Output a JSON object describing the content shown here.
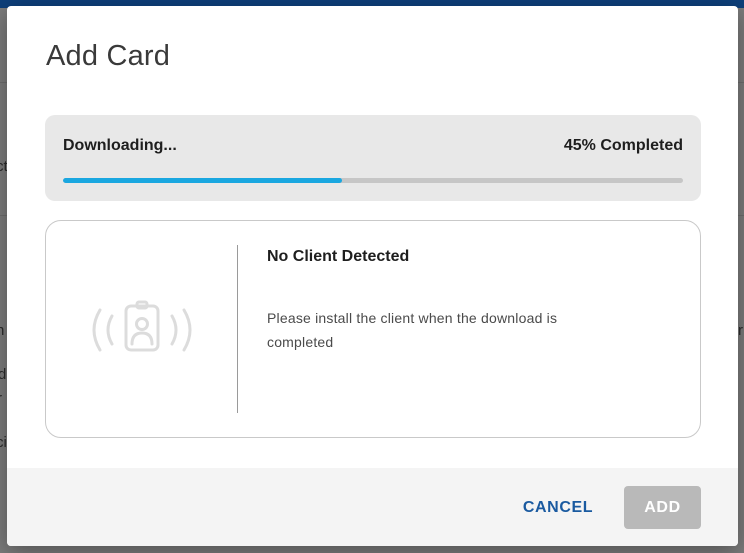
{
  "background": {
    "fragments": [
      "n",
      "d",
      "r",
      "ci",
      "ct",
      "r"
    ]
  },
  "dialog": {
    "title": "Add Card",
    "progress": {
      "status": "Downloading...",
      "percent_label": "45% Completed",
      "value": 0.45,
      "fill_color": "#1aa7e0",
      "track_color": "#c6c6c6"
    },
    "client": {
      "icon": "id-card-signal-icon",
      "heading": "No Client Detected",
      "message": "Please install the client when the download is completed"
    },
    "footer": {
      "cancel_label": "CANCEL",
      "add_label": "ADD"
    }
  },
  "colors": {
    "accent": "#1aa7e0",
    "link": "#1a5aa0",
    "disabled_button": "#b9b9b9",
    "topbar": "#0d3f7a"
  }
}
